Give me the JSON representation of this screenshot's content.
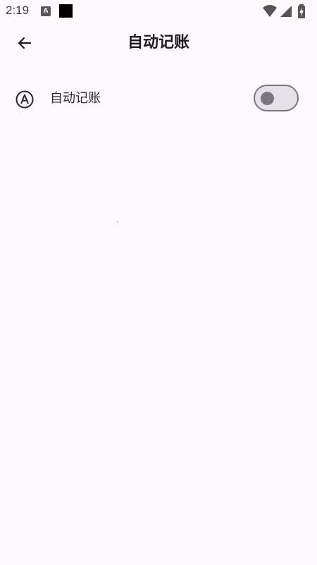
{
  "status_bar": {
    "time": "2:19",
    "notification_letter": "A",
    "icons": [
      "text-notification-icon",
      "black-square-icon",
      "wifi-icon",
      "cellular-signal-icon",
      "battery-charging-icon"
    ]
  },
  "app_bar": {
    "title": "自动记账",
    "back_icon": "arrow-back-icon"
  },
  "settings": {
    "auto_bookkeeping": {
      "label": "自动记账",
      "icon": "circled-a-icon",
      "enabled": false
    }
  },
  "colors": {
    "background": "#fcf8fc",
    "text": "#1c1b1f",
    "toggle_track": "#e6e1e6",
    "toggle_outline": "#7a7680"
  }
}
